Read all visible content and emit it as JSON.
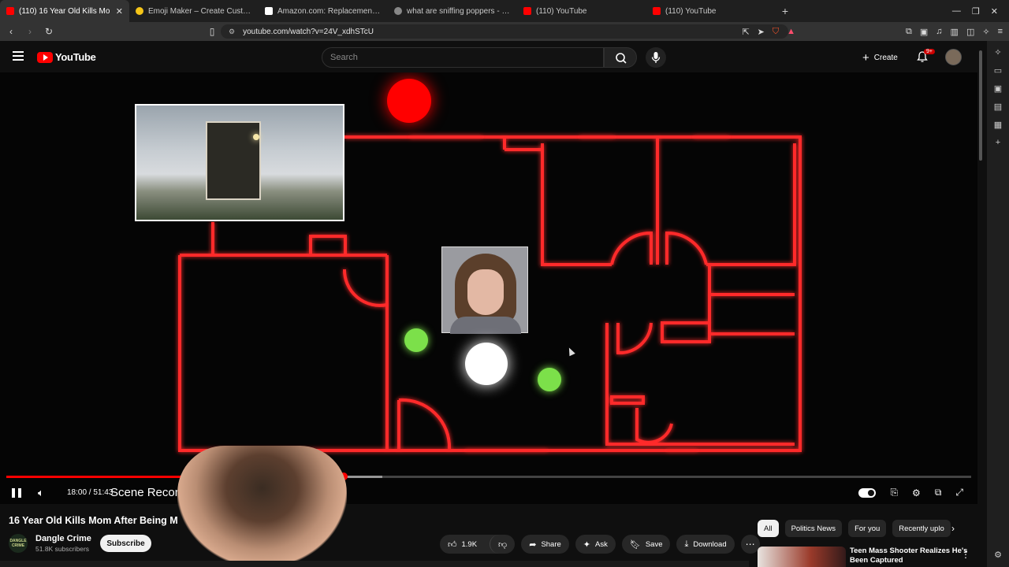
{
  "browser": {
    "tabs": [
      {
        "title": "(110) 16 Year Old Kills Mo",
        "active": true,
        "favicon_color": "#ff0000"
      },
      {
        "title": "Emoji Maker – Create Custom &",
        "active": false,
        "favicon_color": "#f5c518"
      },
      {
        "title": "Amazon.com: Replacement CPU",
        "active": false,
        "favicon_color": "#ffffff"
      },
      {
        "title": "what are sniffing poppers - Brav",
        "active": false,
        "favicon_color": "#888888"
      },
      {
        "title": "(110) YouTube",
        "active": false,
        "favicon_color": "#ff0000"
      },
      {
        "title": "(110) YouTube",
        "active": false,
        "favicon_color": "#ff0000"
      }
    ],
    "url": "youtube.com/watch?v=24V_xdhSTcU"
  },
  "youtube": {
    "logo_text": "YouTube",
    "search_placeholder": "Search",
    "create_label": "Create",
    "notification_count": "9+"
  },
  "player": {
    "time": "18:00 / 51:43",
    "chapter": "Scene Reconstructio",
    "progress": 0.35,
    "buffered": 0.39
  },
  "video": {
    "title": "16 Year Old Kills Mom After Being M",
    "channel": "Dangle Crime",
    "channel_avatar_text": "DANGLE CRIME",
    "subscribers": "51.8K subscribers",
    "subscribe_label": "Subscribe",
    "likes": "1.9K",
    "share_label": "Share",
    "ask_label": "Ask",
    "save_label": "Save",
    "download_label": "Download"
  },
  "recommendations": {
    "chips": [
      "All",
      "Politics News",
      "For you",
      "Recently uplo"
    ],
    "first_title": "Teen Mass Shooter Realizes He's Been Captured"
  },
  "colors": {
    "accent_red": "#ff0000",
    "floorplan_line": "#ff2a2a",
    "marker_green": "#7ce04a"
  }
}
